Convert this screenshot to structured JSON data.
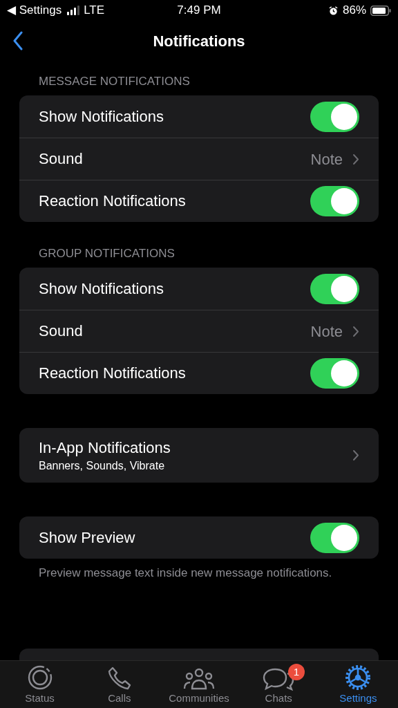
{
  "status_bar": {
    "back_label": "◀ Settings",
    "network": "LTE",
    "time": "7:49 PM",
    "battery": "86%"
  },
  "nav": {
    "title": "Notifications"
  },
  "sections": [
    {
      "header": "MESSAGE NOTIFICATIONS",
      "rows": [
        {
          "kind": "toggle",
          "label": "Show Notifications",
          "on": true
        },
        {
          "kind": "link",
          "label": "Sound",
          "value": "Note"
        },
        {
          "kind": "toggle",
          "label": "Reaction Notifications",
          "on": true
        }
      ]
    },
    {
      "header": "GROUP NOTIFICATIONS",
      "rows": [
        {
          "kind": "toggle",
          "label": "Show Notifications",
          "on": true
        },
        {
          "kind": "link",
          "label": "Sound",
          "value": "Note"
        },
        {
          "kind": "toggle",
          "label": "Reaction Notifications",
          "on": true
        }
      ]
    },
    {
      "rows": [
        {
          "kind": "link",
          "label": "In-App Notifications",
          "subtitle": "Banners, Sounds, Vibrate"
        }
      ]
    },
    {
      "rows": [
        {
          "kind": "toggle",
          "label": "Show Preview",
          "on": true
        }
      ],
      "footer": "Preview message text inside new message notifications."
    }
  ],
  "tab_bar": [
    {
      "kind": "status",
      "label": "Status",
      "selected": false
    },
    {
      "kind": "calls",
      "label": "Calls",
      "selected": false
    },
    {
      "kind": "communities",
      "label": "Communities",
      "selected": false
    },
    {
      "kind": "chats",
      "label": "Chats",
      "selected": false,
      "badge": "1"
    },
    {
      "kind": "settings",
      "label": "Settings",
      "selected": true
    }
  ]
}
